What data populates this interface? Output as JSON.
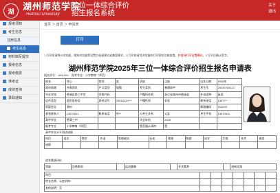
{
  "header": {
    "logo_char": "湖",
    "brand_cn": "湖州师范学院",
    "brand_en": "Huzhou University",
    "system_line1": "三位一体综合评价",
    "system_line2": "招生报名系统",
    "about": "关于",
    "exit": "退出"
  },
  "sidebar": {
    "items": [
      {
        "label": "报考须知"
      },
      {
        "label": "考生信息"
      },
      {
        "label": "注册信息"
      },
      {
        "label": "考生信息"
      },
      {
        "label": "材料填写提交"
      },
      {
        "label": "报考信息"
      },
      {
        "label": "报考缴费"
      },
      {
        "label": "准考证"
      },
      {
        "label": "成绩查询"
      },
      {
        "label": "录取通知"
      }
    ]
  },
  "main": {
    "breadcrumb": "首页 ＞ 首页 ＞ 申请表",
    "print_button": "打印",
    "notice_line1": "1.打印前请将IE浏览器、搜狗浏览器等设置为极速模式或兼容模式，2.打印前请用浏览器的打印预览功能查看，",
    "notice_red": "并保持打印设置横向，",
    "notice_line2": "3.打印后确认签字。",
    "form_title": "湖州师范学院2025年三位一体综合评价招生报名申请表",
    "meta_left": "报名序号：1601000",
    "meta_mid": "报考专业：",
    "meta_mid_val": "小学教育（师范）",
    "section_study": "高中学业水平测试成绩",
    "section_comp": "综合素质评价",
    "section_exam": "考试科目",
    "section_award": "获奖情况"
  },
  "form_rows": [
    [
      "姓名",
      "徐心",
      "性别",
      "女",
      "民族",
      "汉族",
      "出生日期",
      "2008年"
    ],
    [
      "政治面貌",
      "共青团员",
      "户口类别",
      "城镇",
      "考生类别",
      "普通高中",
      "考生号",
      "25330784113"
    ],
    [
      "毕业学校",
      "德清县第三中学",
      "学校代码",
      "",
      "户籍所在地",
      "浙江省湖州市德清县",
      "外语语种",
      "英语"
    ],
    [
      "证件类型",
      "居民身份证",
      "身份证号",
      "33018120***",
      "户籍性质",
      "非农",
      "联系电话",
      "1357***"
    ],
    [
      "家庭住址",
      "湖州",
      "",
      "",
      "",
      "",
      "邮政编码",
      "313200"
    ],
    [
      "紧急联系人",
      "13570611",
      "联系电话",
      "徐**",
      "与考生关系",
      "父女",
      "考生手机",
      "13570611"
    ],
    [
      "高中学业",
      "德清三中",
      "",
      "",
      "毕业年份",
      "2025",
      "",
      ""
    ],
    [
      "报考专业",
      "小学教育（师范）",
      "",
      "",
      "是否服从调剂",
      "是",
      "",
      ""
    ]
  ],
  "study_headers": [
    "科目",
    "语文",
    "数学",
    "外语",
    "思想政治",
    "历史",
    "地理",
    "物理",
    "化学",
    "生物",
    "技术",
    "通用"
  ],
  "study_rows": [
    [
      "成绩",
      "",
      "",
      "",
      "",
      "",
      "",
      "",
      "",
      "",
      "",
      ""
    ]
  ],
  "comp_rows": [
    [
      "等级",
      "品德表现",
      "",
      "运动健康",
      "",
      "艺术素养",
      "",
      "创新实践"
    ]
  ],
  "extra_rows": [
    [
      "科目",
      "",
      "",
      "",
      "",
      "",
      "",
      ""
    ],
    [
      "特长名称、认定机构：",
      "",
      "",
      "",
      "",
      "",
      "",
      ""
    ],
    [
      "其他说明：无",
      "",
      "",
      "",
      "",
      "",
      "",
      ""
    ]
  ]
}
